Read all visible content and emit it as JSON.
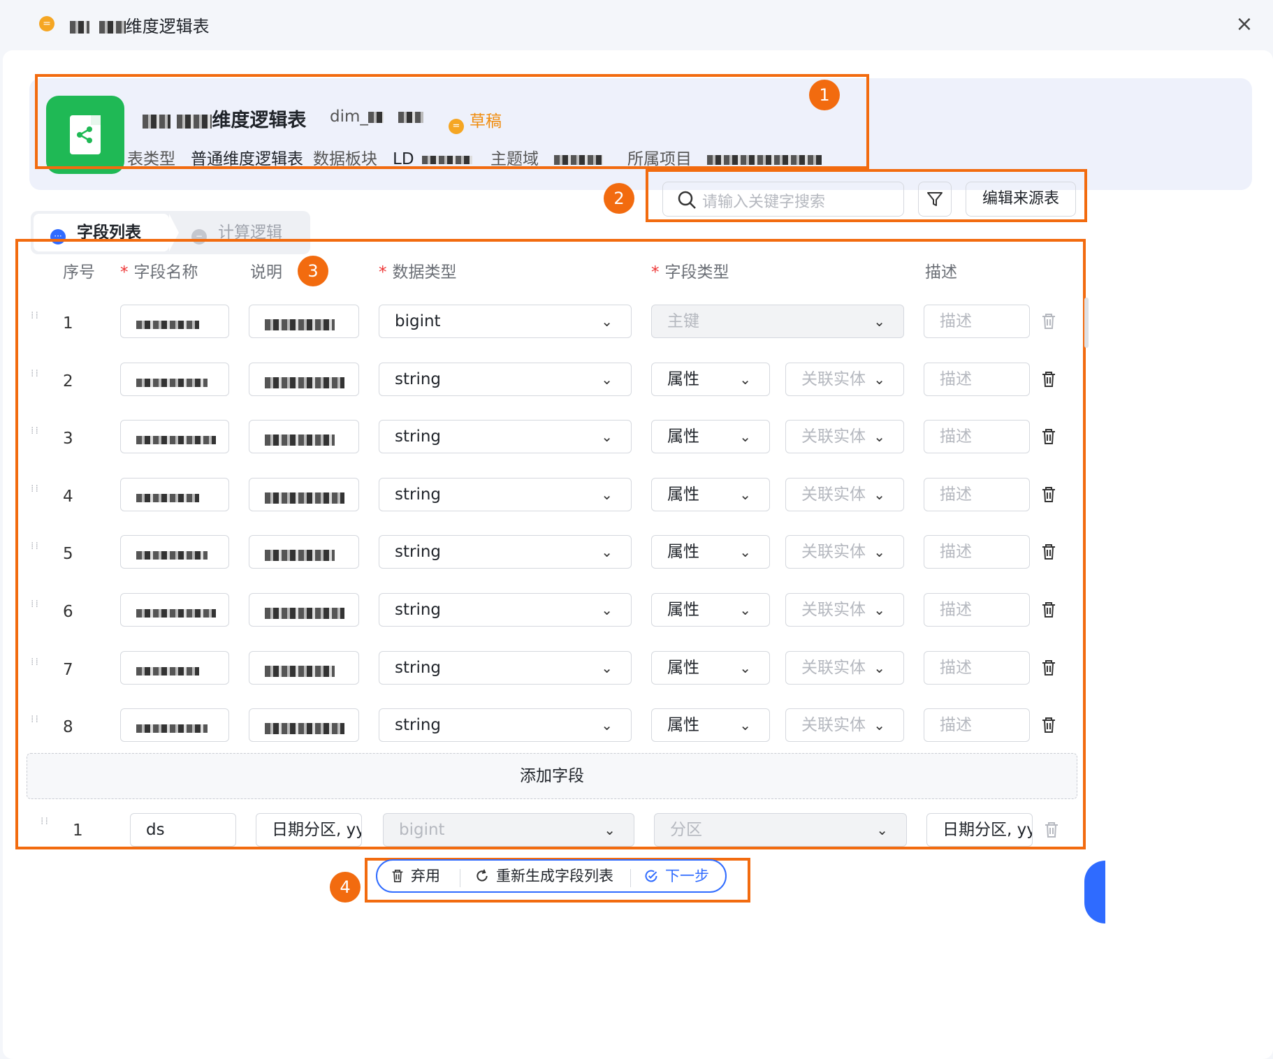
{
  "window": {
    "title_masked": "■ ■",
    "title_suffix": "维度逻辑表",
    "status_glyph": "="
  },
  "header": {
    "name_suffix": "维度逻辑表",
    "code_prefix": "dim_",
    "status": "草稿",
    "meta": [
      {
        "key": "表类型",
        "value": "普通维度逻辑表"
      },
      {
        "key": "数据板块",
        "value": "LD_"
      },
      {
        "key": "主题域",
        "value": ""
      },
      {
        "key": "所属项目",
        "value": ""
      }
    ]
  },
  "tabs": [
    {
      "label": "字段列表",
      "active": true
    },
    {
      "label": "计算逻辑",
      "active": false
    }
  ],
  "toolbar": {
    "search_placeholder": "请输入关键字搜索",
    "edit_source_label": "编辑来源表"
  },
  "table": {
    "columns": [
      "序号",
      "字段名称",
      "说明",
      "数据类型",
      "字段类型",
      "描述"
    ],
    "required_mark": "*",
    "desc_placeholder": "描述",
    "link_entity_placeholder": "关联实体",
    "rows": [
      {
        "index": "1",
        "data_type": "bigint",
        "field_type": "主键"
      },
      {
        "index": "2",
        "data_type": "string",
        "field_type": "属性"
      },
      {
        "index": "3",
        "data_type": "string",
        "field_type": "属性"
      },
      {
        "index": "4",
        "data_type": "string",
        "field_type": "属性"
      },
      {
        "index": "5",
        "data_type": "string",
        "field_type": "属性"
      },
      {
        "index": "6",
        "data_type": "string",
        "field_type": "属性"
      },
      {
        "index": "7",
        "data_type": "string",
        "field_type": "属性"
      },
      {
        "index": "8",
        "data_type": "string",
        "field_type": "属性"
      }
    ],
    "add_field_label": "添加字段",
    "partition_row": {
      "index": "1",
      "name": "ds",
      "explain": "日期分区, yy",
      "data_type": "bigint",
      "field_type": "分区",
      "desc": "日期分区, yy"
    }
  },
  "footer": {
    "discard_label": "弃用",
    "regenerate_label": "重新生成字段列表",
    "next_label": "下一步"
  },
  "callouts": [
    "1",
    "2",
    "3",
    "4"
  ],
  "colors": {
    "accent": "#2f6bff",
    "callout": "#f26b0f",
    "status": "#f08c0e",
    "app_icon": "#1fb955"
  }
}
